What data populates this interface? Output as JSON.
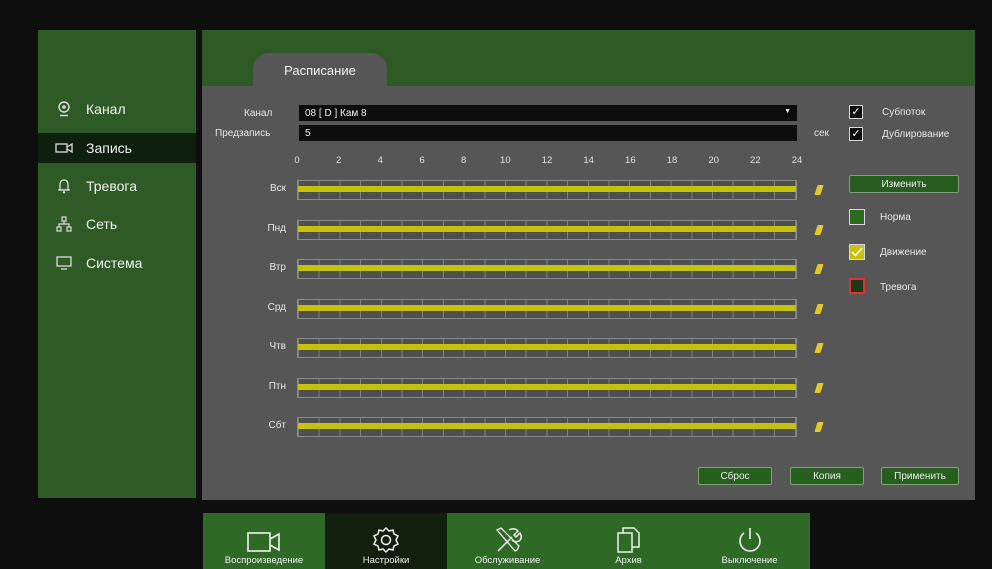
{
  "tab": {
    "label": "Расписание"
  },
  "sidebar": {
    "items": [
      {
        "label": "Канал",
        "icon": "camera-icon"
      },
      {
        "label": "Запись",
        "icon": "record-icon",
        "active": true
      },
      {
        "label": "Тревога",
        "icon": "bell-icon"
      },
      {
        "label": "Сеть",
        "icon": "network-icon"
      },
      {
        "label": "Система",
        "icon": "monitor-icon"
      }
    ]
  },
  "form": {
    "channel_label": "Канал",
    "channel_value": "08 [ D ] Кам 8",
    "prerecord_label": "Предзапись",
    "prerecord_value": "5",
    "prerecord_unit": "сек"
  },
  "options": {
    "saturday": {
      "label": "Субпоток",
      "checked": true
    },
    "duplication": {
      "label": "Дублирование",
      "checked": true
    }
  },
  "schedule": {
    "hours": [
      "0",
      "2",
      "4",
      "6",
      "8",
      "10",
      "12",
      "14",
      "16",
      "18",
      "20",
      "22",
      "24"
    ],
    "days": [
      "Вск",
      "Пнд",
      "Втр",
      "Срд",
      "Чтв",
      "Птн",
      "Сбт"
    ],
    "mode_color": "#c6c20b"
  },
  "edit_button": "Изменить",
  "legend": [
    {
      "label": "Норма",
      "color": "#2a6b20",
      "border": "#d8d8d8"
    },
    {
      "label": "Движение",
      "color": "#c6c20b",
      "border": "#d8d8d8"
    },
    {
      "label": "Тревога",
      "color": "#1d3a18",
      "border": "#e03030"
    }
  ],
  "buttons": {
    "reset": "Сброс",
    "copy": "Копия",
    "apply": "Применить"
  },
  "nav": [
    {
      "label": "Воспроизведение",
      "icon": "playback-icon"
    },
    {
      "label": "Настройки",
      "icon": "settings-icon",
      "active": true
    },
    {
      "label": "Обслуживание",
      "icon": "maintenance-icon"
    },
    {
      "label": "Архив",
      "icon": "archive-icon"
    },
    {
      "label": "Выключение",
      "icon": "power-icon"
    }
  ]
}
